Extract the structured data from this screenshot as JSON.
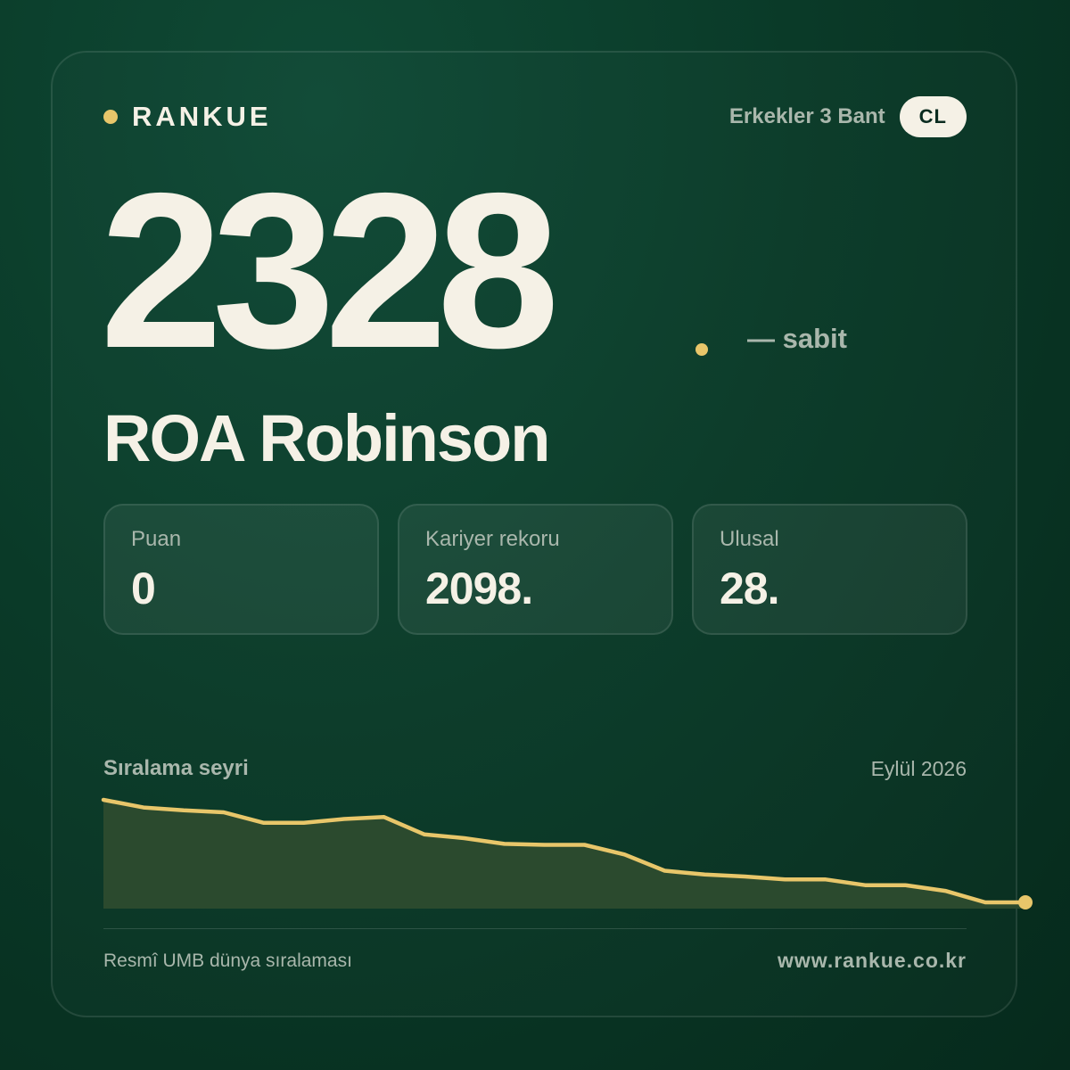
{
  "brand": {
    "name": "RANKUE",
    "dot_color": "#e8c66a"
  },
  "category": {
    "label": "Erkekler 3 Bant",
    "badge": "CL"
  },
  "rank": {
    "value": "2328",
    "trend_text": "— sabit"
  },
  "player": {
    "name": "ROA Robinson"
  },
  "stats": [
    {
      "label": "Puan",
      "value": "0"
    },
    {
      "label": "Kariyer rekoru",
      "value": "2098."
    },
    {
      "label": "Ulusal",
      "value": "28."
    }
  ],
  "trend_section": {
    "title": "Sıralama seyri",
    "date": "Eylül 2026"
  },
  "chart_data": {
    "type": "area",
    "title": "Sıralama seyri",
    "values": [
      1730,
      1810,
      1840,
      1860,
      1970,
      1970,
      1930,
      1910,
      2090,
      2130,
      2190,
      2200,
      2200,
      2300,
      2470,
      2510,
      2530,
      2560,
      2560,
      2620,
      2620,
      2680,
      2800,
      2800
    ],
    "y_inverted": true,
    "grid": false,
    "line_color": "#e8c66a",
    "fill_color": "#2b4a2e"
  },
  "footer": {
    "source": "Resmî UMB dünya sıralaması",
    "url": "www.rankue.co.kr"
  }
}
